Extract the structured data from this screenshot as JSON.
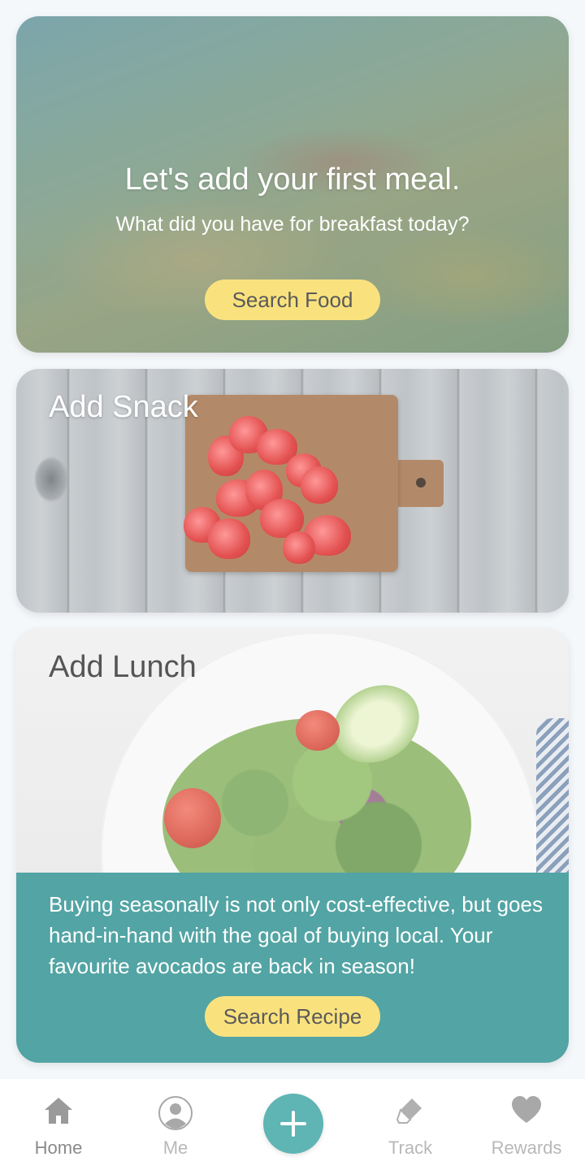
{
  "breakfast_card": {
    "title": "Let's add your first meal.",
    "subtitle": "What did you have for breakfast today?",
    "button_label": "Search Food"
  },
  "snack_card": {
    "title": "Add Snack"
  },
  "lunch_card": {
    "title": "Add Lunch",
    "tip_text": "Buying seasonally is not only cost-effective, but goes hand-in-hand with the goal of buying local. Your favourite avocados are back in season!",
    "button_label": "Search Recipe"
  },
  "bottom_nav": {
    "items": [
      {
        "label": "Home",
        "icon": "home-icon",
        "active": true
      },
      {
        "label": "Me",
        "icon": "profile-icon",
        "active": false
      },
      {
        "label": "",
        "icon": "plus-icon",
        "active": false
      },
      {
        "label": "Track",
        "icon": "eraser-icon",
        "active": false
      },
      {
        "label": "Rewards",
        "icon": "heart-icon",
        "active": false
      }
    ]
  },
  "colors": {
    "accent_yellow": "#f9e27e",
    "teal": "#53a4a4",
    "add_button": "#5fb4b4"
  }
}
